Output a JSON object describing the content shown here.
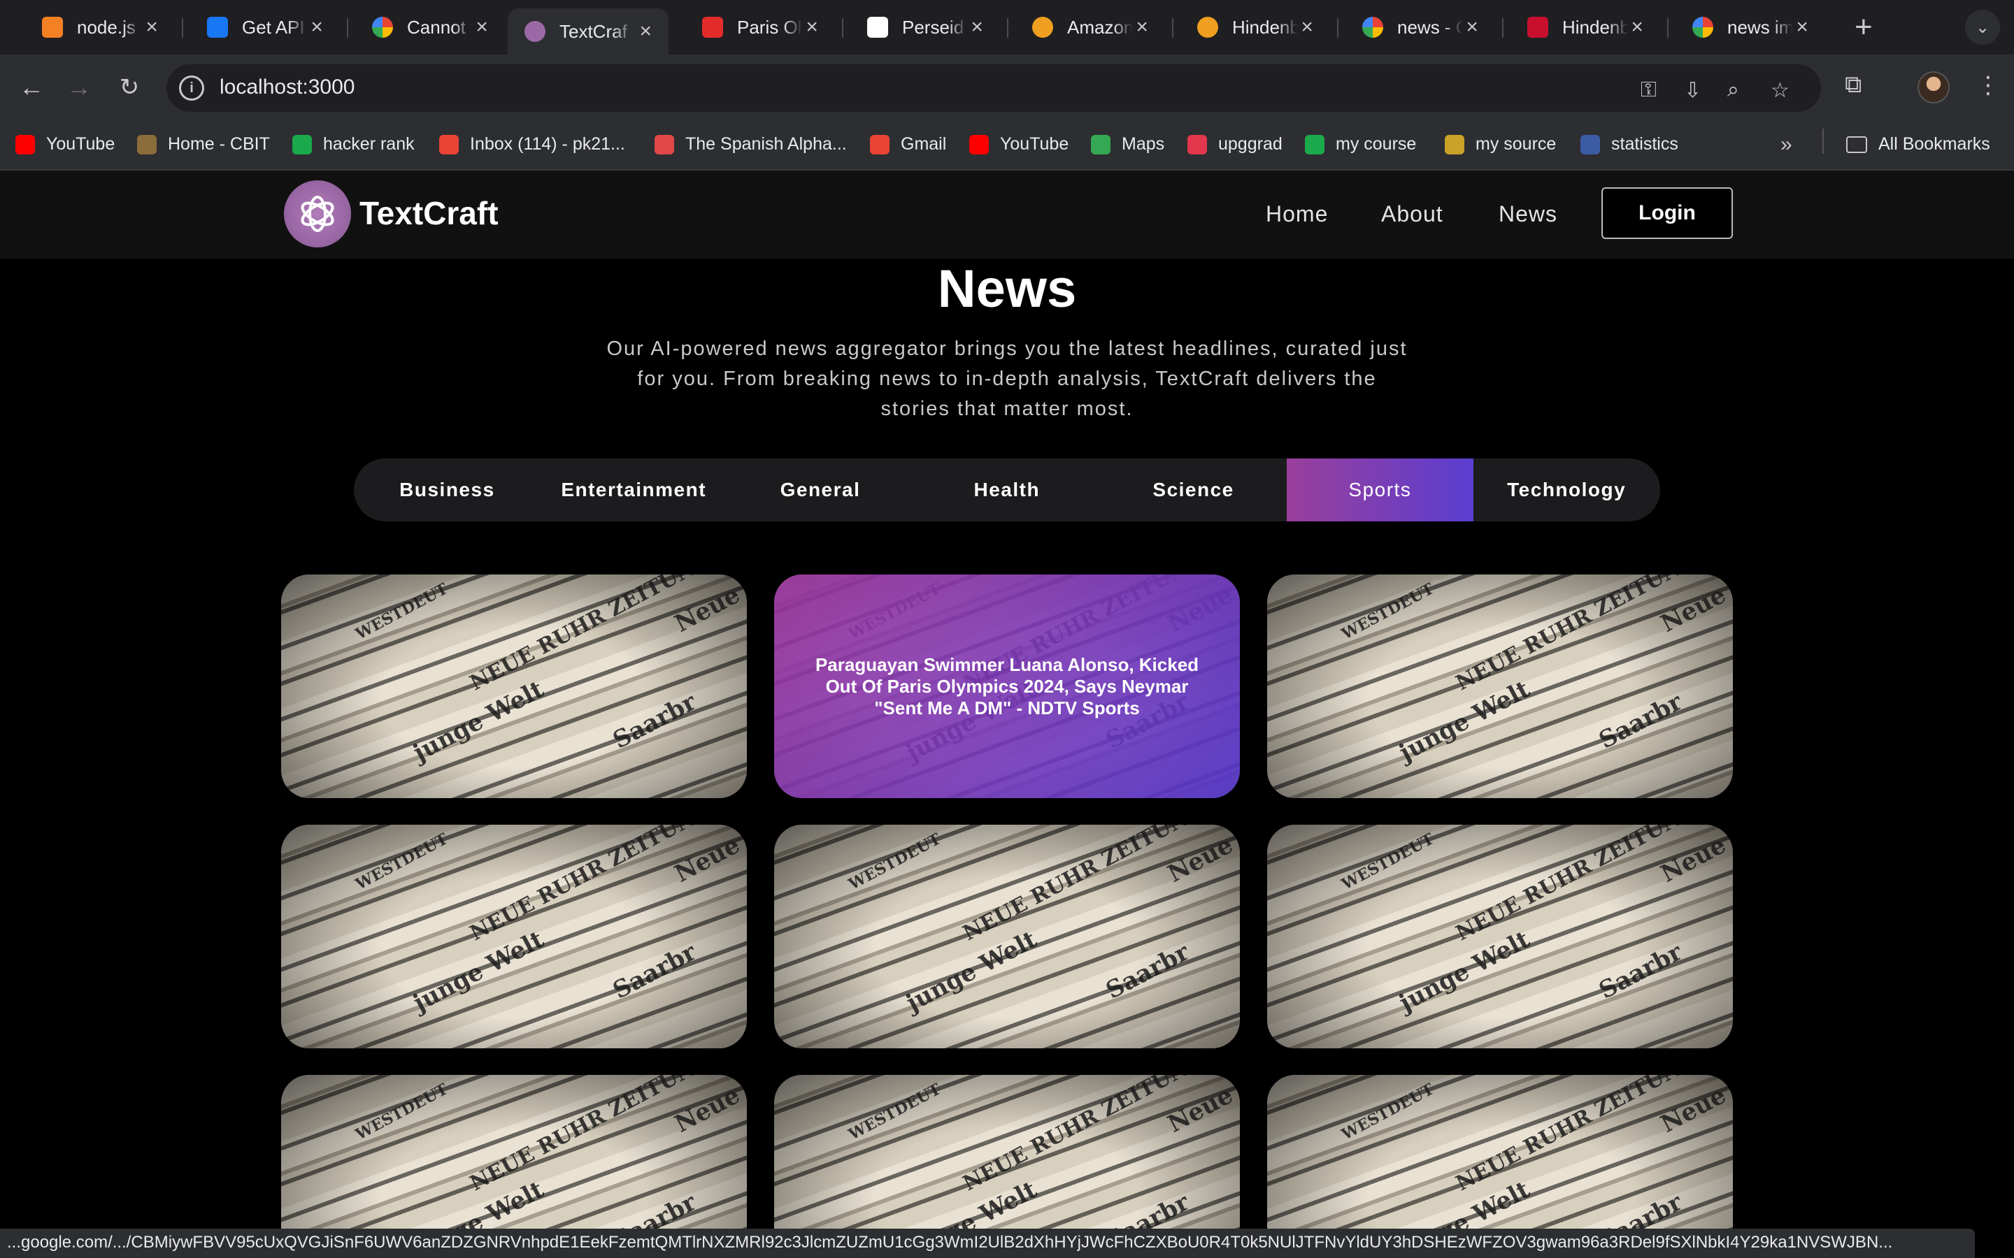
{
  "browser": {
    "tabs": [
      {
        "title": "node.js",
        "icon": "stackoverflow-icon",
        "color": "#f48024"
      },
      {
        "title": "Get API",
        "icon": "butterfly-icon",
        "color": "#1877f2"
      },
      {
        "title": "Cannot f",
        "icon": "google-icon",
        "color": "#ffffff"
      },
      {
        "title": "TextCraf",
        "icon": "textcraft-icon",
        "color": "#9b6aa6",
        "active": true
      },
      {
        "title": "Paris Oly",
        "icon": "news18-icon",
        "color": "#e32b2b"
      },
      {
        "title": "Perseid",
        "icon": "toi-icon",
        "color": "#ffffff"
      },
      {
        "title": "Amazon",
        "icon": "moneycontrol-icon",
        "color": "#f0a020"
      },
      {
        "title": "Hindenb",
        "icon": "moneycontrol-icon",
        "color": "#f0a020"
      },
      {
        "title": "news - C",
        "icon": "google-icon",
        "color": "#ffffff"
      },
      {
        "title": "Hindenb",
        "icon": "ndtv-icon",
        "color": "#c8102e"
      },
      {
        "title": "news im",
        "icon": "google-icon",
        "color": "#ffffff"
      }
    ],
    "address": "localhost:3000",
    "bookmarks": [
      {
        "label": "YouTube",
        "icon": "youtube-icon",
        "color": "#ff0000"
      },
      {
        "label": "Home - CBIT",
        "icon": "cbit-icon",
        "color": "#8a6d3b"
      },
      {
        "label": "hacker rank",
        "icon": "hackerrank-icon",
        "color": "#1ba94c"
      },
      {
        "label": "Inbox (114) - pk21...",
        "icon": "gmail-icon",
        "color": "#ea4335"
      },
      {
        "label": "The Spanish Alpha...",
        "icon": "lips-icon",
        "color": "#e04848"
      },
      {
        "label": "Gmail",
        "icon": "gmail-icon",
        "color": "#ea4335"
      },
      {
        "label": "YouTube",
        "icon": "youtube-icon",
        "color": "#ff0000"
      },
      {
        "label": "Maps",
        "icon": "maps-icon",
        "color": "#34a853"
      },
      {
        "label": "upggrad",
        "icon": "upgrad-icon",
        "color": "#e2374c"
      },
      {
        "label": "my course",
        "icon": "course-icon",
        "color": "#1ba94c"
      },
      {
        "label": "my source",
        "icon": "source-icon",
        "color": "#c9a227"
      },
      {
        "label": "statistics",
        "icon": "statistics-icon",
        "color": "#3b5ba5"
      }
    ],
    "all_bookmarks": "All Bookmarks",
    "status_url": "...google.com/.../CBMiywFBVV95cUxQVGJiSnF6UWV6anZDZGNRVnhpdE1EekFzemtQMTlrNXZMRl92c3JlcmZUZmU1cGg3WmI2UlB2dXhHYjJWcFhCZXBoU0R4T0k5NUlJTFNvYldUY3hDSHEzWFZOV3gwam96a3RDel9fSXlNbkI4Y29ka1NVSWJBN..."
  },
  "site": {
    "brand": "TextCraft",
    "nav": {
      "home": "Home",
      "about": "About",
      "news": "News",
      "login": "Login"
    },
    "title": "News",
    "description": "Our AI-powered news aggregator brings you the latest headlines, curated just for you. From breaking news to in-depth analysis, TextCraft delivers the stories that matter most.",
    "categories": [
      "Business",
      "Entertainment",
      "General",
      "Health",
      "Science",
      "Sports",
      "Technology"
    ],
    "active_category": "Sports",
    "accent_gradient": [
      "#9a3f9b",
      "#5a3ed0"
    ],
    "cards": [
      {
        "headline": ""
      },
      {
        "headline": "Paraguayan Swimmer Luana Alonso, Kicked Out Of Paris Olympics 2024, Says Neymar \"Sent Me A DM\" - NDTV Sports",
        "hovered": true
      },
      {
        "headline": ""
      },
      {
        "headline": ""
      },
      {
        "headline": ""
      },
      {
        "headline": ""
      },
      {
        "headline": ""
      },
      {
        "headline": ""
      },
      {
        "headline": ""
      }
    ]
  }
}
